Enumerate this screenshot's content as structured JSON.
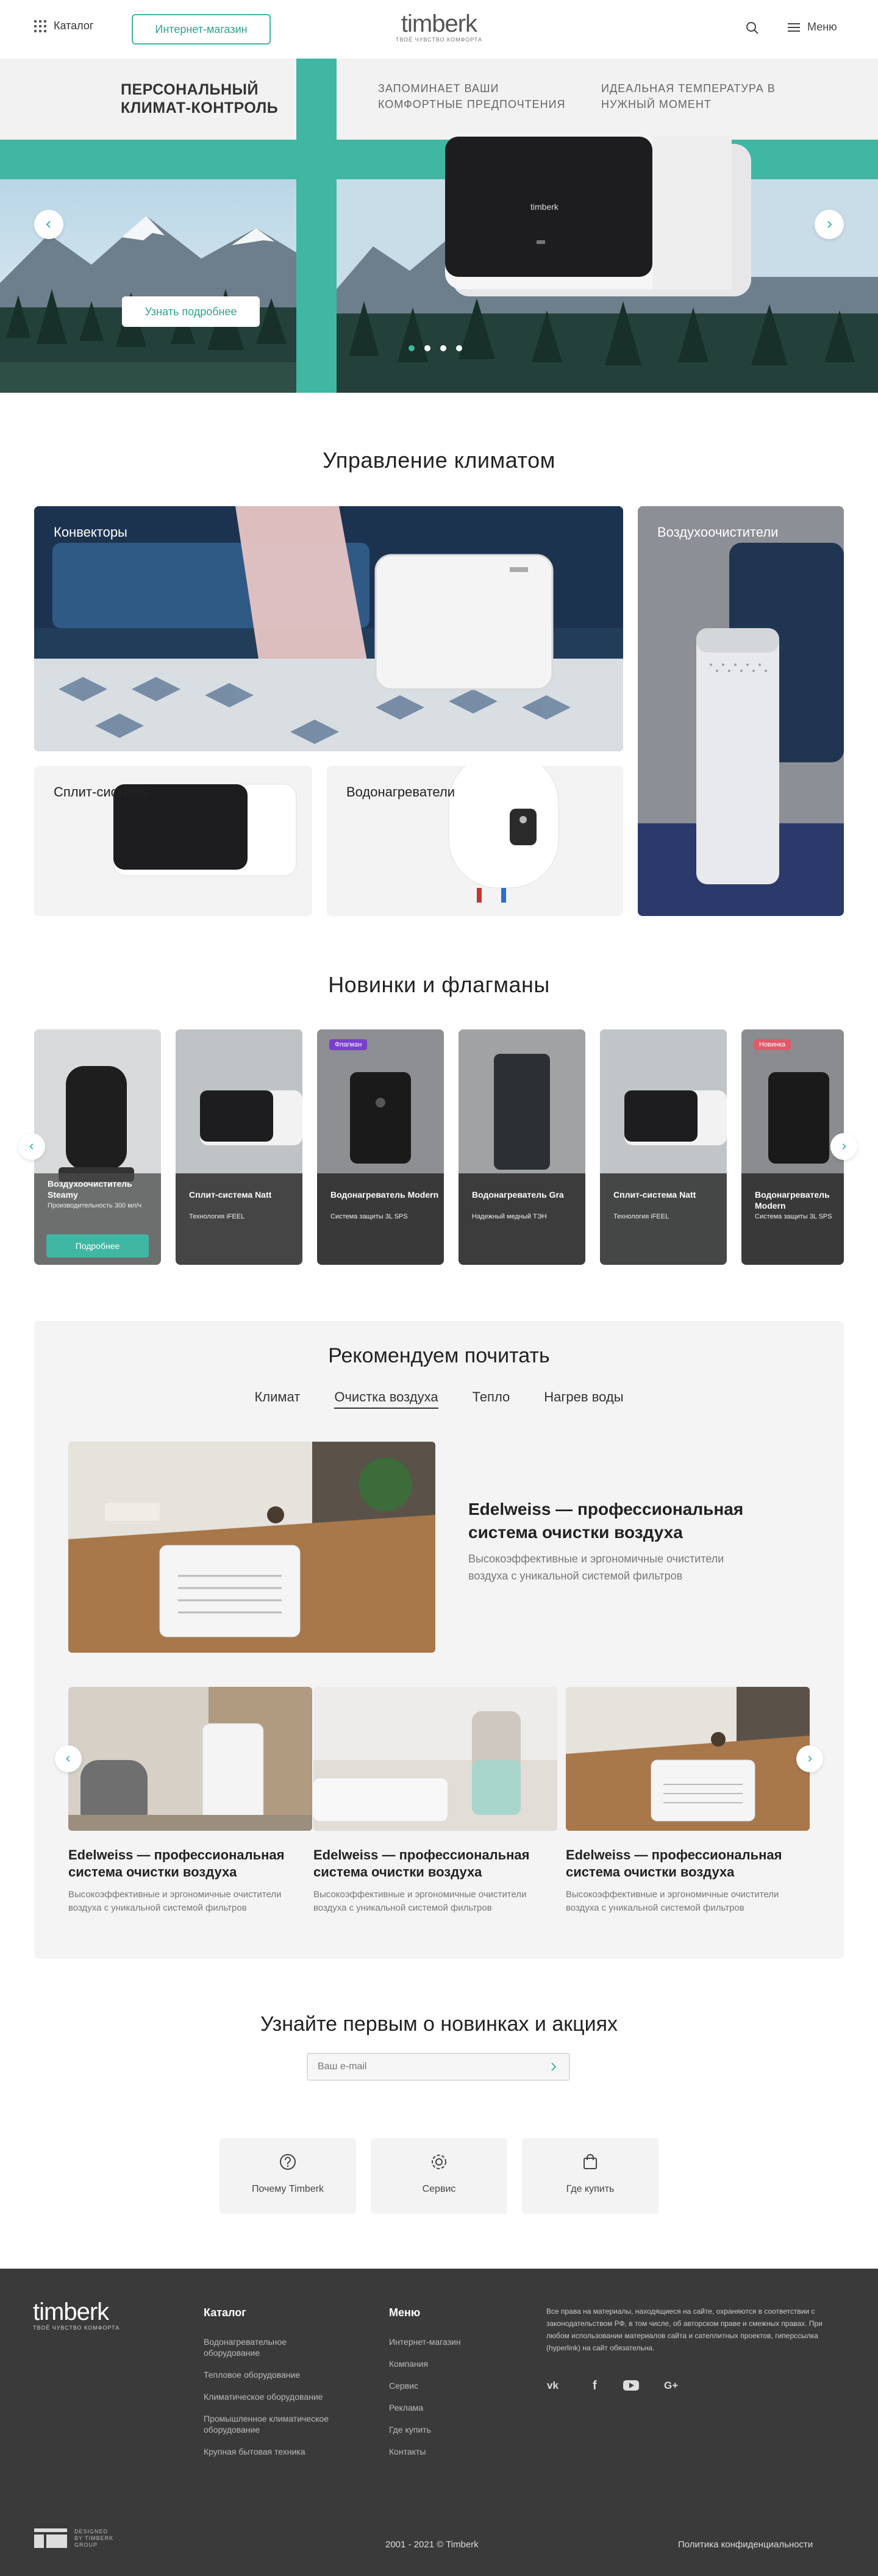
{
  "header": {
    "catalog_label": "Каталог",
    "shop_label": "Интернет-магазин",
    "logo_text": "timberk",
    "logo_slogan": "ТВОЁ ЧУВСТВО КОМФОРТА",
    "menu_label": "Меню"
  },
  "hero": {
    "title": "ПЕРСОНАЛЬНЫЙ КЛИМАТ-КОНТРОЛЬ",
    "feature_1": "ЗАПОМИНАЕТ ВАШИ КОМФОРТНЫЕ ПРЕДПОЧТЕНИЯ",
    "feature_2": "ИДЕАЛЬНАЯ ТЕМПЕРАТУРА В НУЖНЫЙ МОМЕНТ",
    "cta_label": "Узнать подробнее",
    "ac_brand": "timberk",
    "slides_total": 4,
    "slide_active": 1
  },
  "climate": {
    "title": "Управление климатом",
    "cards": [
      {
        "label": "Конвекторы"
      },
      {
        "label": "Воздухоочистители"
      },
      {
        "label": "Сплит-системы"
      },
      {
        "label": "Водонагреватели"
      }
    ]
  },
  "products": {
    "title": "Новинки и флагманы",
    "items": [
      {
        "name": "Воздухоочиститель Steamy",
        "feature": "Производительность 300 мл/ч",
        "button": "Подробнее",
        "badge": ""
      },
      {
        "name": "Сплит-система Natt",
        "feature": "Технология iFEEL",
        "badge": ""
      },
      {
        "name": "Водонагреватель Modern",
        "feature": "Система защиты 3L SPS",
        "badge": "Флагман"
      },
      {
        "name": "Водонагреватель Gra",
        "feature": "Надежный медный ТЭН",
        "badge": ""
      },
      {
        "name": "Сплит-система Natt",
        "feature": "Технология iFEEL",
        "badge": ""
      },
      {
        "name": "Водонагреватель Modern",
        "feature": "Система защиты 3L SPS",
        "badge": "Новинка"
      }
    ],
    "colors": {
      "flag": "#7a3fd0",
      "new": "#e05a6a"
    }
  },
  "reading": {
    "title": "Рекомендуем почитать",
    "tabs": [
      "Климат",
      "Очистка воздуха",
      "Тепло",
      "Нагрев воды"
    ],
    "active_tab": 1,
    "featured": {
      "title": "Edelweiss — профессиональная система очистки воздуха",
      "text": "Высокоэффективные и эргономичные очистители воздуха с уникальной системой фильтров"
    },
    "articles": [
      {
        "title": "Edelweiss — профессиональная система очистки воздуха",
        "text": "Высокоэффективные и эргономичные очистители воздуха с уникальной системой фильтров"
      },
      {
        "title": "Edelweiss — профессиональная система очистки воздуха",
        "text": "Высокоэффективные и эргономичные очистители воздуха с уникальной системой фильтров"
      },
      {
        "title": "Edelweiss — профессиональная система очистки воздуха",
        "text": "Высокоэффективные и эргономичные очистители воздуха с уникальной системой фильтров"
      }
    ]
  },
  "newsletter": {
    "title": "Узнайте первым о новинках и акциях",
    "placeholder": "Ваш e-mail"
  },
  "tiles": [
    {
      "label": "Почему Timberk",
      "icon": "question-icon"
    },
    {
      "label": "Сервис",
      "icon": "gear-icon"
    },
    {
      "label": "Где купить",
      "icon": "bag-icon"
    }
  ],
  "footer": {
    "logo_text": "timberk",
    "logo_slogan": "ТВОЁ ЧУВСТВО КОМФОРТА",
    "catalog_title": "Каталог",
    "catalog_links": [
      "Водонагревательное оборудование",
      "Тепловое оборудование",
      "Климатическое оборудование",
      "Промышленное климатическое оборудование",
      "Крупная бытовая техника"
    ],
    "menu_title": "Меню",
    "menu_links": [
      "Интернет-магазин",
      "Компания",
      "Сервис",
      "Реклама",
      "Где купить",
      "Контакты"
    ],
    "legal": "Все права на материалы, находящиеся на сайте, охраняются в соответствии с законодательством РФ, в том числе, об авторском праве и смежных правах. При любом использовании материалов сайта и сателлитных проектов, гиперссылка (hyperlink) на сайт обязательна.",
    "social": [
      "vk-icon",
      "facebook-icon",
      "youtube-icon",
      "google-plus-icon"
    ],
    "designed_by": "DESIGNED BY TIMBERK GROUP",
    "copyright": "2001 - 2021 © Timberk",
    "privacy": "Политика конфиденциальности"
  },
  "colors": {
    "accent": "#3fb7a3",
    "footer_bg": "#3a3a3a"
  }
}
